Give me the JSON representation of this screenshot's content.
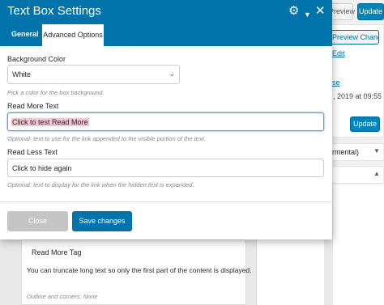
{
  "background": {
    "top_preview_label": "Preview",
    "top_update_label": "Update",
    "preview_changes_label": "Preview Changes",
    "edit_link_1": "Edit",
    "edit_link_2": "",
    "edit_link_3": "se",
    "publish_date": ", 2019 at 09:55",
    "side_update_label": "Update",
    "format_label": "rmental)",
    "card_title": "Read More Tag",
    "card_text": "You can truncate long text so only the first part of the content is displayed.",
    "card_note": "Outline and corners: None"
  },
  "modal": {
    "title": "Text Box Settings",
    "tabs": [
      {
        "label": "General"
      },
      {
        "label": "Advanced Options"
      }
    ],
    "background_color": {
      "label": "Background Color",
      "value": "White",
      "help": "Pick a color for the box background."
    },
    "read_more": {
      "label": "Read More Text",
      "value": "Click to test Read More",
      "help": "Optional: text to use for the link appended to the visible portion of the text."
    },
    "read_less": {
      "label": "Read Less Text",
      "value": "Click to hide again",
      "help": "Optional: text to display for the link when the hidden text is expanded."
    },
    "close_label": "Close",
    "save_label": "Save changes"
  },
  "icons": {
    "gear": "gear-icon",
    "chevron": "chevron-down-icon",
    "close": "close-icon"
  },
  "colors": {
    "header_blue": "#0073aa",
    "primary_button": "#0073aa",
    "selection_highlight": "#f3c6d0"
  }
}
